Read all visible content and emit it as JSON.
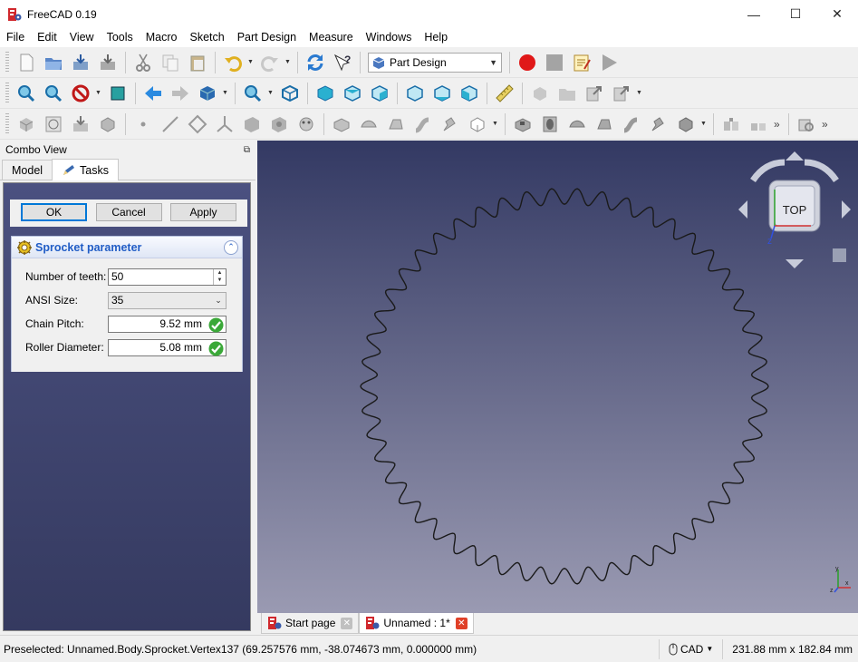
{
  "window": {
    "title": "FreeCAD 0.19",
    "minimize": "—",
    "maximize": "☐",
    "close": "✕"
  },
  "menu": [
    "File",
    "Edit",
    "View",
    "Tools",
    "Macro",
    "Sketch",
    "Part Design",
    "Measure",
    "Windows",
    "Help"
  ],
  "toolbar": {
    "workbench": "Part Design"
  },
  "combo": {
    "title": "Combo View",
    "tabs": {
      "model": "Model",
      "tasks": "Tasks"
    },
    "buttons": {
      "ok": "OK",
      "cancel": "Cancel",
      "apply": "Apply"
    },
    "panel": {
      "title": "Sprocket parameter",
      "teeth_label": "Number of teeth:",
      "teeth_value": "50",
      "ansi_label": "ANSI Size:",
      "ansi_value": "35",
      "pitch_label": "Chain Pitch:",
      "pitch_value": "9.52 mm",
      "roller_label": "Roller Diameter:",
      "roller_value": "5.08 mm"
    }
  },
  "view": {
    "navcube_face": "TOP",
    "axis_x": "x",
    "axis_y": "y",
    "axis_z": "z",
    "colors": {
      "sprocket": "#1a1a1a"
    }
  },
  "doctabs": [
    {
      "label": "Start page"
    },
    {
      "label": "Unnamed : 1*"
    }
  ],
  "status": {
    "message": "Preselected: Unnamed.Body.Sprocket.Vertex137 (69.257576 mm, -38.074673 mm, 0.000000 mm)",
    "nav_style": "CAD",
    "dimensions": "231.88 mm x 182.84 mm"
  }
}
